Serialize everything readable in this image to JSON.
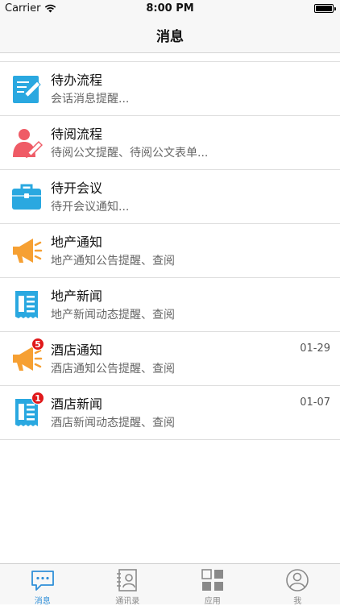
{
  "status_bar": {
    "carrier": "Carrier",
    "time": "8:00 PM"
  },
  "nav": {
    "title": "消息"
  },
  "messages": [
    {
      "title": "待办流程",
      "subtitle": "会话消息提醒...",
      "icon": "edit-document-icon",
      "color": "#2aa8e0"
    },
    {
      "title": "待阅流程",
      "subtitle": "待阅公文提醒、待阅公文表单...",
      "icon": "user-edit-icon",
      "color": "#ef5b66"
    },
    {
      "title": "待开会议",
      "subtitle": "待开会议通知...",
      "icon": "briefcase-icon",
      "color": "#2aa8e0"
    },
    {
      "title": "地产通知",
      "subtitle": "地产通知公告提醒、查阅",
      "icon": "megaphone-icon",
      "color": "#f6a033"
    },
    {
      "title": "地产新闻",
      "subtitle": "地产新闻动态提醒、查阅",
      "icon": "newspaper-icon",
      "color": "#2aa8e0"
    },
    {
      "title": "酒店通知",
      "subtitle": "酒店通知公告提醒、查阅",
      "icon": "megaphone-icon",
      "color": "#f6a033",
      "date": "01-29",
      "badge": "5"
    },
    {
      "title": "酒店新闻",
      "subtitle": "酒店新闻动态提醒、查阅",
      "icon": "newspaper-icon",
      "color": "#2aa8e0",
      "date": "01-07",
      "badge": "1"
    }
  ],
  "tabs": [
    {
      "label": "消息",
      "icon": "chat-bubble-icon",
      "active": true
    },
    {
      "label": "通讯录",
      "icon": "contacts-book-icon",
      "active": false
    },
    {
      "label": "应用",
      "icon": "apps-grid-icon",
      "active": false
    },
    {
      "label": "我",
      "icon": "profile-circle-icon",
      "active": false
    }
  ],
  "colors": {
    "accent": "#2f8fd8",
    "badge": "#e0191b"
  }
}
